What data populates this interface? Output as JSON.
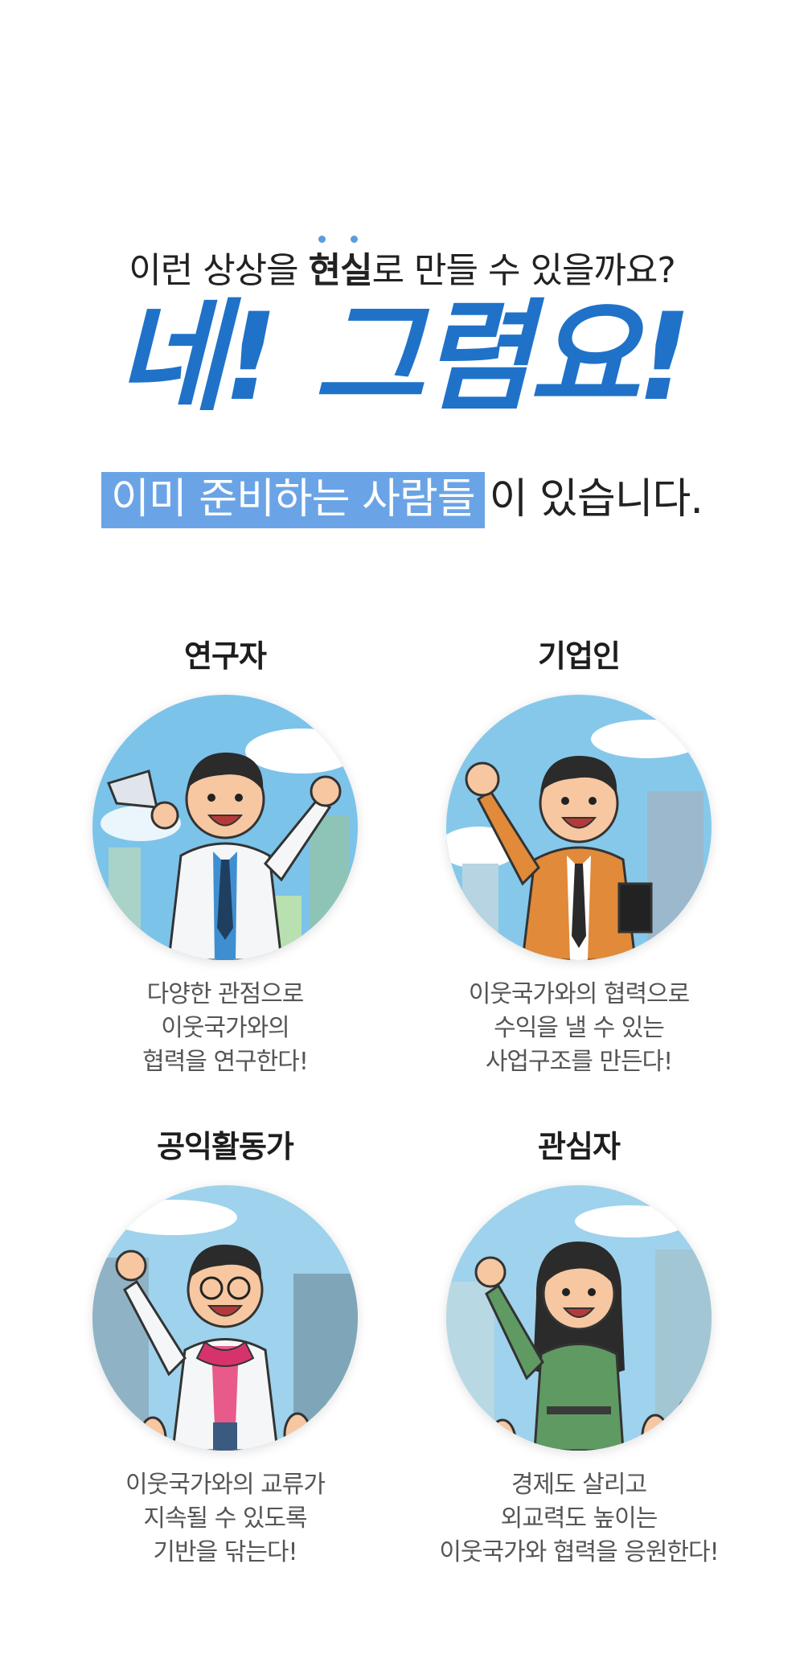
{
  "intro": {
    "prefix": "이런 상상을 ",
    "emphasis": "현실",
    "suffix": "로 만들 수 있을까요?"
  },
  "headline": "네! 그렴요!",
  "ready": {
    "highlight": "이미 준비하는 사람들",
    "rest": "이 있습니다."
  },
  "colors": {
    "brand_blue": "#1f72c8",
    "highlight_bg": "#6aa4e6"
  },
  "cards": [
    {
      "role": "연구자",
      "illustration": "researcher-with-megaphone",
      "lines": [
        "다양한 관점으로",
        "이웃국가와의",
        "협력을 연구한다!"
      ]
    },
    {
      "role": "기업인",
      "illustration": "businessman-waving",
      "lines": [
        "이웃국가와의 협력으로",
        "수익을 낼 수 있는",
        "사업구조를 만든다!"
      ]
    },
    {
      "role": "공익활동가",
      "illustration": "activist-with-crowd",
      "lines": [
        "이웃국가와의 교류가",
        "지속될 수 있도록",
        "기반을 닦는다!"
      ]
    },
    {
      "role": "관심자",
      "illustration": "citizen-woman-waving",
      "lines": [
        "경제도 살리고",
        "외교력도 높이는",
        "이웃국가와 협력을 응원한다!"
      ]
    }
  ]
}
